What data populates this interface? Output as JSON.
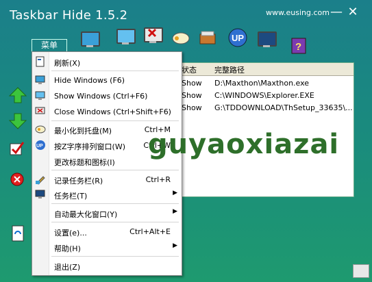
{
  "window": {
    "title": "Taskbar Hide 1.5.2",
    "site": "www.eusing.com",
    "min_label": "—",
    "close_label": "✕"
  },
  "menu_tab": "菜单",
  "list": {
    "headers": [
      "状态",
      "完整路径"
    ],
    "rows": [
      {
        "status": "Show",
        "path": "D:\\Maxthon\\Maxthon.exe"
      },
      {
        "status": "Show",
        "path": "C:\\WINDOWS\\Explorer.EXE"
      },
      {
        "status": "Show",
        "path": "G:\\TDDOWNLOAD\\ThSetup_33635\\..."
      }
    ]
  },
  "context_menu": {
    "items": [
      {
        "label": "刷新(X)",
        "shortcut": "",
        "icon": "refresh-icon"
      },
      {
        "label": "Hide Windows  (F6)",
        "shortcut": "",
        "icon": "hide-window-icon"
      },
      {
        "label": "Show Windows  (Ctrl+F6)",
        "shortcut": "",
        "icon": "show-window-icon"
      },
      {
        "label": "Close Windows  (Ctrl+Shift+F6)",
        "shortcut": "",
        "icon": "close-window-icon"
      },
      {
        "label": "最小化到托盘(M)",
        "shortcut": "Ctrl+M",
        "icon": "tray-icon"
      },
      {
        "label": "按Z字序排列窗口(W)",
        "shortcut": "Ctrl+W",
        "icon": "up-icon"
      },
      {
        "label": "更改标题和图标(I)",
        "shortcut": "",
        "icon": ""
      },
      {
        "label": "记录任务栏(R)",
        "shortcut": "Ctrl+R",
        "icon": "record-icon"
      },
      {
        "label": "任务栏(T)",
        "shortcut": "",
        "icon": "taskbar-icon",
        "submenu": true
      },
      {
        "label": "自动最大化窗口(Y)",
        "shortcut": "",
        "icon": "",
        "submenu": true
      },
      {
        "label": "设置(e)...",
        "shortcut": "Ctrl+Alt+E",
        "icon": ""
      },
      {
        "label": "帮助(H)",
        "shortcut": "",
        "icon": "",
        "submenu": true
      },
      {
        "label": "退出(Z)",
        "shortcut": "",
        "icon": ""
      }
    ]
  },
  "watermark": "guyaoxiazai",
  "colors": {
    "window_bg": "#1b8a80",
    "accent_blue": "#3aa0d8",
    "watermark": "#2e6f2a"
  }
}
